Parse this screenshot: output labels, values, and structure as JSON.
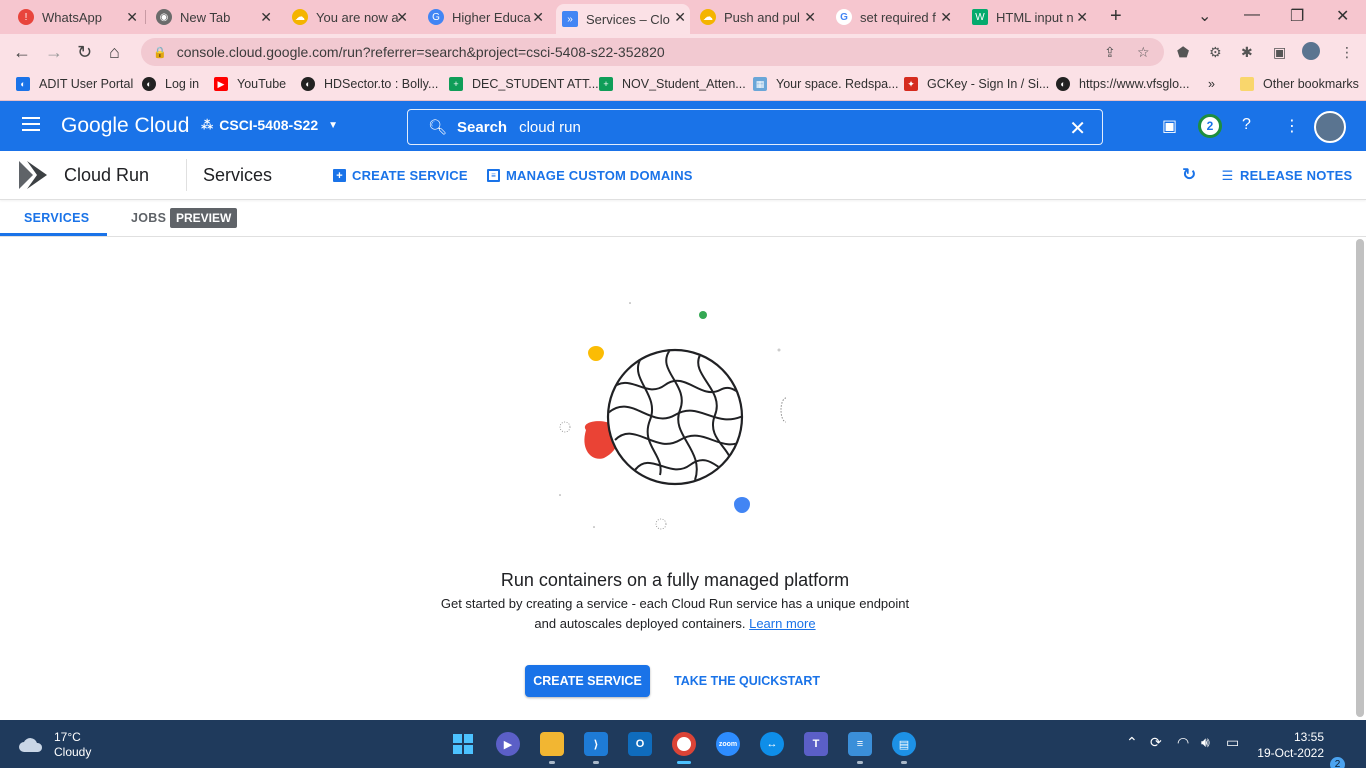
{
  "browser": {
    "tabs": [
      {
        "title": "WhatsApp",
        "icon": "whatsapp-icon"
      },
      {
        "title": "New Tab",
        "icon": "chrome-icon"
      },
      {
        "title": "You are now a",
        "icon": "google-cloud-icon"
      },
      {
        "title": "Higher Educa",
        "icon": "google-icon"
      },
      {
        "title": "Services – Clo",
        "icon": "cloud-run-icon"
      },
      {
        "title": "Push and pul",
        "icon": "google-cloud-icon"
      },
      {
        "title": "set required f",
        "icon": "google-icon"
      },
      {
        "title": "HTML input n",
        "icon": "w3schools-icon"
      }
    ],
    "url": "console.cloud.google.com/run?referrer=search&project=csci-5408-s22-352820",
    "bookmarks": [
      {
        "label": "ADIT User Portal"
      },
      {
        "label": "Log in"
      },
      {
        "label": "YouTube"
      },
      {
        "label": "HDSector.to : Bolly..."
      },
      {
        "label": "DEC_STUDENT ATT..."
      },
      {
        "label": "NOV_Student_Atten..."
      },
      {
        "label": "Your space. Redspa..."
      },
      {
        "label": "GCKey - Sign In / Si..."
      },
      {
        "label": "https://www.vfsglo..."
      }
    ],
    "bookmarks_more": "»",
    "other_bookmarks": "Other bookmarks"
  },
  "gcp": {
    "logo": "Google Cloud",
    "project": "CSCI-5408-S22",
    "search_label": "Search",
    "search_query": "cloud run",
    "notifications_count": "2"
  },
  "product": {
    "name": "Cloud Run",
    "page": "Services",
    "create_service": "CREATE SERVICE",
    "manage_domains": "MANAGE CUSTOM DOMAINS",
    "release_notes": "RELEASE NOTES"
  },
  "tabs": {
    "services": "SERVICES",
    "jobs": "JOBS",
    "preview_badge": "PREVIEW"
  },
  "empty_state": {
    "headline": "Run containers on a fully managed platform",
    "line1": "Get started by creating a service - each Cloud Run service has a unique endpoint",
    "line2": "and autoscales deployed containers.",
    "learn_more": "Learn more",
    "primary_button": "CREATE SERVICE",
    "secondary_button": "TAKE THE QUICKSTART"
  },
  "taskbar": {
    "temperature": "17°C",
    "weather": "Cloudy",
    "time": "13:55",
    "date": "19-Oct-2022",
    "notification_count": "2"
  },
  "colors": {
    "gcp_blue": "#1a73e8",
    "tab_strip": "#f6c6cf",
    "taskbar": "#1f3a5c"
  }
}
